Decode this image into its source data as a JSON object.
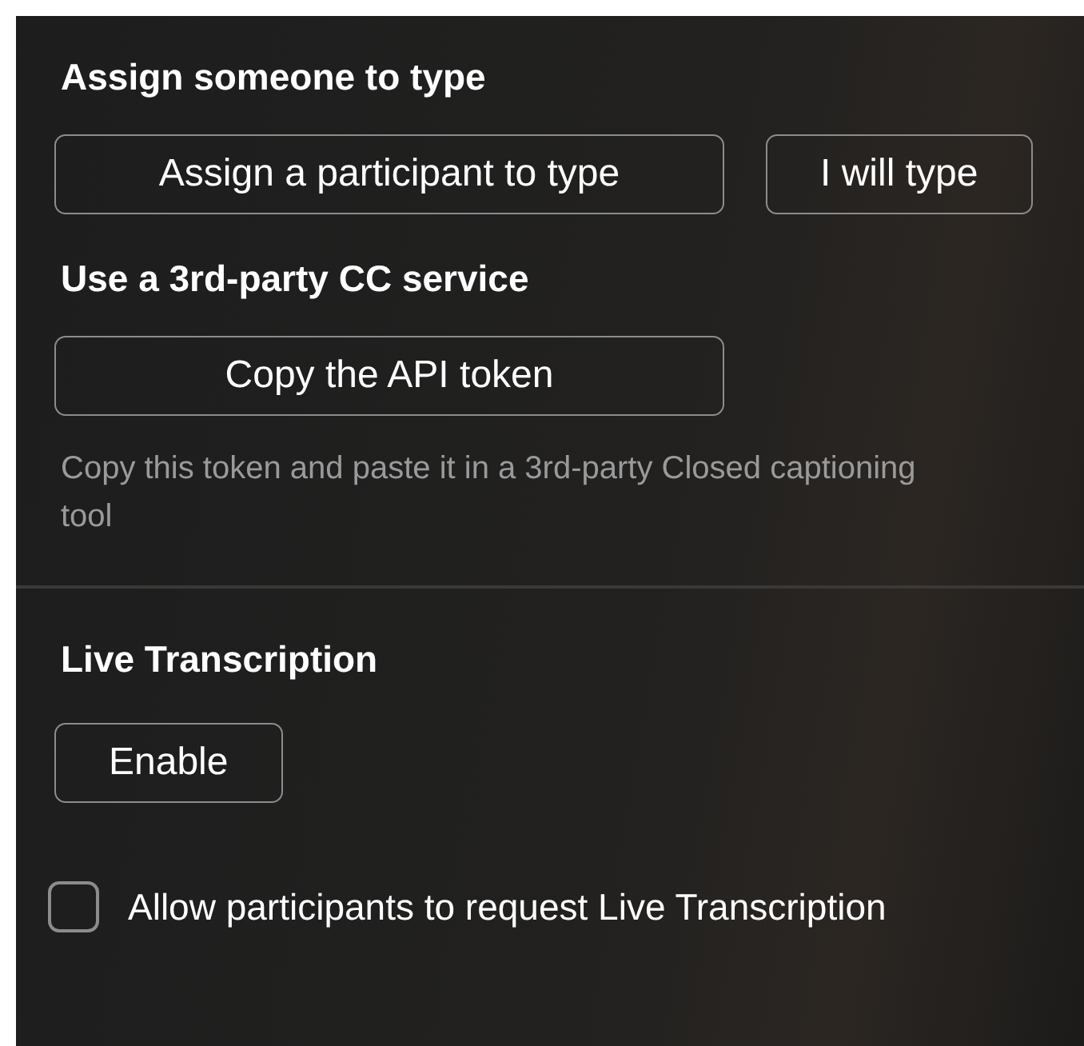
{
  "sections": [
    {
      "heading": "Assign someone to type",
      "buttons": [
        {
          "label": "Assign a participant to type",
          "wide": true
        },
        {
          "label": "I will type",
          "wide": false
        }
      ]
    },
    {
      "heading": "Use a 3rd-party CC service",
      "buttons": [
        {
          "label": "Copy the API token",
          "wide": true
        }
      ],
      "note": "Copy this token and paste it in a 3rd-party Closed captioning tool"
    },
    {
      "heading": "Live Transcription",
      "divider_above": true,
      "buttons": [
        {
          "label": "Enable",
          "wide": false
        }
      ]
    }
  ],
  "checkbox": {
    "label": "Allow participants to request Live Transcription",
    "checked": false
  }
}
